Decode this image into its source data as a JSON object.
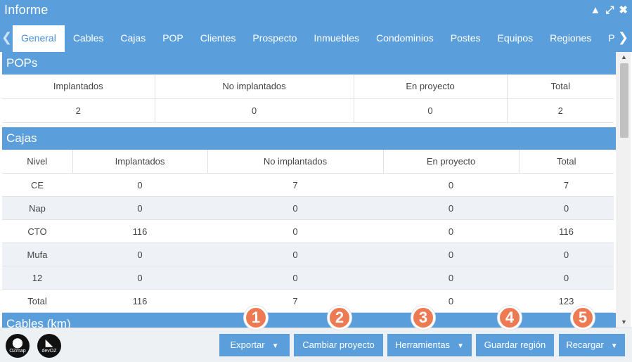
{
  "window": {
    "title": "Informe"
  },
  "tabs": [
    "General",
    "Cables",
    "Cajas",
    "POP",
    "Clientes",
    "Prospecto",
    "Inmuebles",
    "Condominios",
    "Postes",
    "Equipos",
    "Regiones",
    "Pen"
  ],
  "pops": {
    "title": "POPs",
    "headers": [
      "Implantados",
      "No implantados",
      "En proyecto",
      "Total"
    ],
    "values": [
      "2",
      "0",
      "0",
      "2"
    ]
  },
  "cajas": {
    "title": "Cajas",
    "headers": [
      "Nivel",
      "Implantados",
      "No implantados",
      "En proyecto",
      "Total"
    ],
    "rows": [
      [
        "CE",
        "0",
        "7",
        "0",
        "7"
      ],
      [
        "Nap",
        "0",
        "0",
        "0",
        "0"
      ],
      [
        "CTO",
        "116",
        "0",
        "0",
        "116"
      ],
      [
        "Mufa",
        "0",
        "0",
        "0",
        "0"
      ],
      [
        "12",
        "0",
        "0",
        "0",
        "0"
      ],
      [
        "Total",
        "116",
        "7",
        "0",
        "123"
      ]
    ]
  },
  "cables": {
    "title": "Cables (km)"
  },
  "logos": {
    "ozmap": "OZmap",
    "devoz": "devOZ"
  },
  "footer": {
    "buttons": [
      "Exportar",
      "Cambiar proyecto",
      "Herramientas",
      "Guardar región",
      "Recargar"
    ]
  },
  "badges": [
    "1",
    "2",
    "3",
    "4",
    "5"
  ],
  "colors": {
    "primary": "#5a9fdb",
    "badge": "#ee7a54"
  }
}
